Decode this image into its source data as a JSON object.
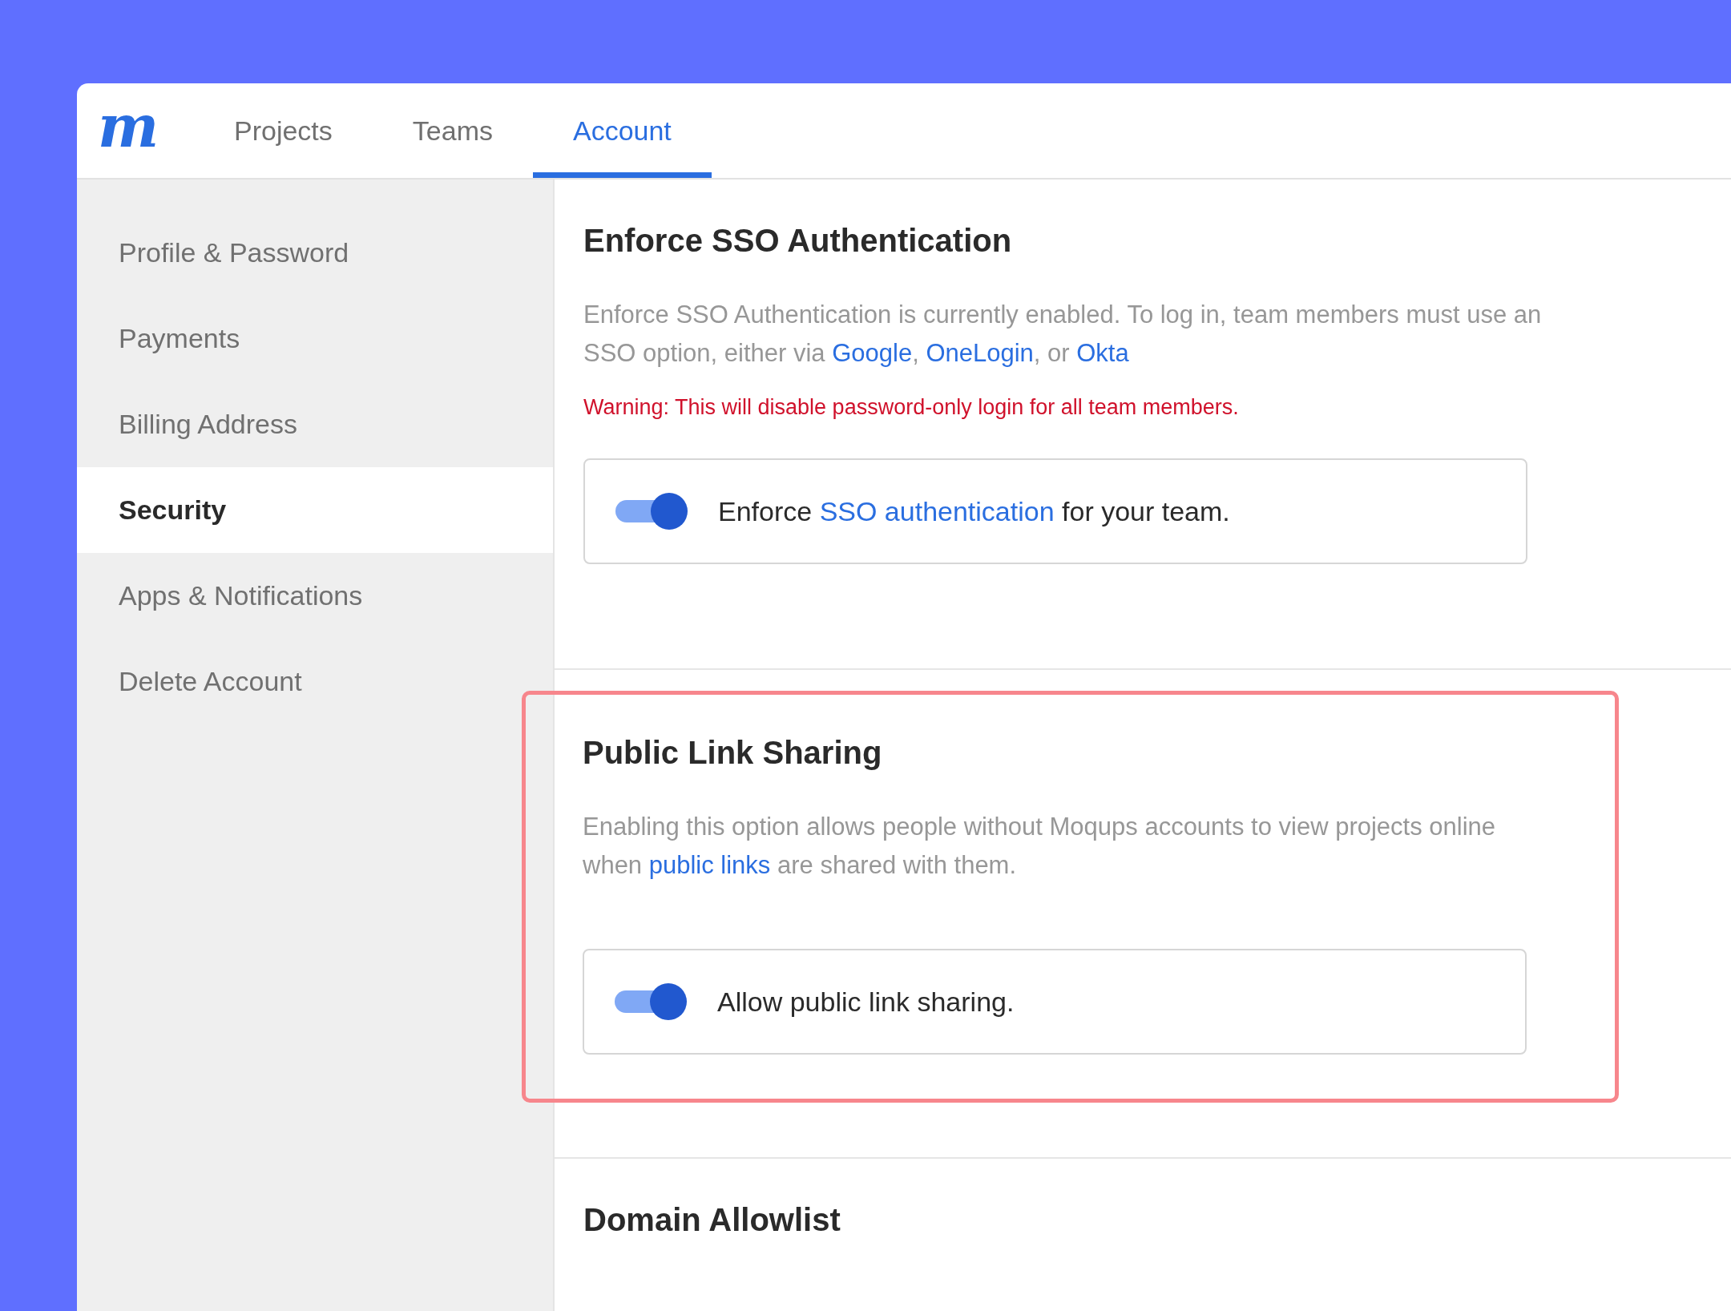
{
  "logo": "m",
  "tabs": [
    {
      "label": "Projects",
      "selected": false
    },
    {
      "label": "Teams",
      "selected": false
    },
    {
      "label": "Account",
      "selected": true
    }
  ],
  "sidebar": {
    "items": [
      {
        "label": "Profile & Password",
        "selected": false
      },
      {
        "label": "Payments",
        "selected": false
      },
      {
        "label": "Billing Address",
        "selected": false
      },
      {
        "label": "Security",
        "selected": true
      },
      {
        "label": "Apps & Notifications",
        "selected": false
      },
      {
        "label": "Delete Account",
        "selected": false
      }
    ]
  },
  "sections": [
    {
      "title": "Enforce SSO Authentication",
      "highlighted": false,
      "description": [
        {
          "kind": "text",
          "text": "Enforce SSO Authentication is currently enabled. To log in, team members must use an SSO option, either via "
        },
        {
          "kind": "link",
          "text": "Google"
        },
        {
          "kind": "text",
          "text": ", "
        },
        {
          "kind": "link",
          "text": "OneLogin"
        },
        {
          "kind": "text",
          "text": ", or "
        },
        {
          "kind": "link",
          "text": "Okta"
        }
      ],
      "warning": "Warning: This will disable password-only login for all team members.",
      "toggle": {
        "on": true,
        "label": [
          {
            "kind": "text",
            "text": "Enforce "
          },
          {
            "kind": "link",
            "text": "SSO authentication"
          },
          {
            "kind": "text",
            "text": " for your team."
          }
        ]
      }
    },
    {
      "title": "Public Link Sharing",
      "highlighted": true,
      "description": [
        {
          "kind": "text",
          "text": "Enabling this option allows people without Moqups accounts to view projects online when "
        },
        {
          "kind": "link",
          "text": "public links"
        },
        {
          "kind": "text",
          "text": " are shared with them."
        }
      ],
      "toggle": {
        "on": true,
        "label": [
          {
            "kind": "text",
            "text": "Allow public link sharing."
          }
        ]
      }
    },
    {
      "title": "Domain Allowlist",
      "highlighted": false
    }
  ]
}
